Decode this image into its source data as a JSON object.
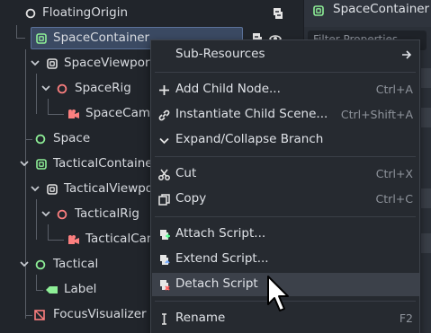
{
  "tree": {
    "nodes": [
      {
        "label": "FloatingOrigin"
      },
      {
        "label": "SpaceContainer"
      },
      {
        "label": "SpaceViewport"
      },
      {
        "label": "SpaceRig"
      },
      {
        "label": "SpaceCame"
      },
      {
        "label": "Space"
      },
      {
        "label": "TacticalContaine"
      },
      {
        "label": "TacticalViewpo"
      },
      {
        "label": "TacticalRig"
      },
      {
        "label": "TacticalCan"
      },
      {
        "label": "Tactical"
      },
      {
        "label": "Label"
      },
      {
        "label": "FocusVisualizer"
      }
    ]
  },
  "inspector": {
    "title": "SpaceContainer",
    "filter_placeholder": "Filter Properties"
  },
  "menu": {
    "items": [
      {
        "label": "Sub-Resources",
        "shortcut": ""
      },
      {
        "label": "Add Child Node...",
        "shortcut": "Ctrl+A"
      },
      {
        "label": "Instantiate Child Scene...",
        "shortcut": "Ctrl+Shift+A"
      },
      {
        "label": "Expand/Collapse Branch",
        "shortcut": ""
      },
      {
        "label": "Cut",
        "shortcut": "Ctrl+X"
      },
      {
        "label": "Copy",
        "shortcut": "Ctrl+C"
      },
      {
        "label": "Attach Script...",
        "shortcut": ""
      },
      {
        "label": "Extend Script...",
        "shortcut": ""
      },
      {
        "label": "Detach Script",
        "shortcut": ""
      },
      {
        "label": "Rename",
        "shortcut": "F2"
      }
    ]
  },
  "colors": {
    "node_green": "#8eef97",
    "node_red": "#fc7f7f",
    "selection": "#3b4a63",
    "menu_bg": "#262a30"
  }
}
